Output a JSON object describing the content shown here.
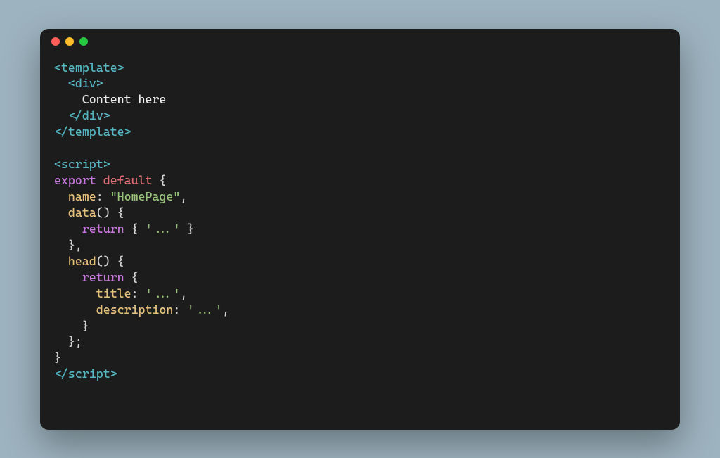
{
  "code": {
    "l1": "<template>",
    "l2_indent": "  ",
    "l2": "<div>",
    "l3_indent": "    ",
    "l3": "Content here",
    "l4_indent": "  ",
    "l4": "</div>",
    "l5": "</template>",
    "l7": "<script>",
    "l8_export": "export",
    "l8_default": " default",
    "l8_rest": " {",
    "l9_indent": "  ",
    "l9_prop": "name",
    "l9_colon": ": ",
    "l9_str": "\"HomePage\"",
    "l9_comma": ",",
    "l10_indent": "  ",
    "l10_prop": "data",
    "l10_rest": "() {",
    "l11_indent": "    ",
    "l11_return": "return",
    "l11_sp": " { ",
    "l11_str": "'...'",
    "l11_end": " }",
    "l12_indent": "  ",
    "l12": "},",
    "l13_indent": "  ",
    "l13_prop": "head",
    "l13_rest": "() {",
    "l14_indent": "    ",
    "l14_return": "return",
    "l14_rest": " {",
    "l15_indent": "      ",
    "l15_prop": "title",
    "l15_colon": ": ",
    "l15_str": "'...'",
    "l15_comma": ",",
    "l16_indent": "      ",
    "l16_prop": "description",
    "l16_colon": ": ",
    "l16_str": "'...'",
    "l16_comma": ",",
    "l17_indent": "    ",
    "l17": "}",
    "l18_indent": "  ",
    "l18": "};",
    "l19": "}",
    "l20_open": "</",
    "l20_name": "script",
    "l20_close": ">"
  }
}
